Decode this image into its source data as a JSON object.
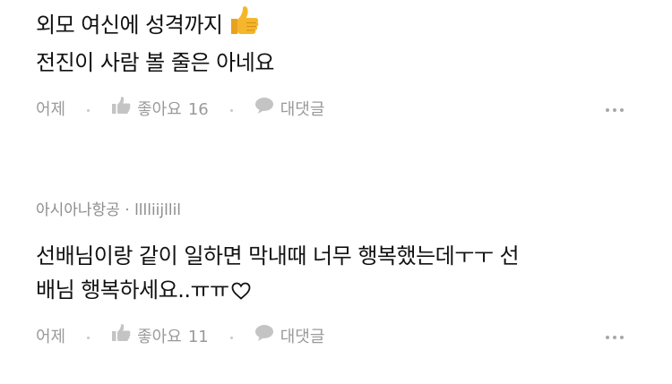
{
  "comments": [
    {
      "author": "",
      "author_sep": "",
      "author_suffix": "",
      "lines": [
        "외모 여신에 성격까지",
        "전진이 사람 볼 줄은 아네요"
      ],
      "emoji": "thumbs-up-emoji",
      "time": "어제",
      "like_label": "좋아요",
      "like_count": "16",
      "reply_label": "대댓글"
    },
    {
      "author": "아시아나항공",
      "author_sep": "·",
      "author_suffix": "lllliijllil",
      "lines": [
        "선배님이랑 같이 일하면 막내때 너무 행복했는데ㅜㅜ 선",
        "배님 행복하세요..ㅠㅠ"
      ],
      "emoji": "heart-outline",
      "time": "어제",
      "like_label": "좋아요",
      "like_count": "11",
      "reply_label": "대댓글"
    }
  ],
  "colors": {
    "text": "#111111",
    "meta": "#8e8e8e",
    "action": "#9a9a9a",
    "icon": "#c4c4c4",
    "emoji": "#f5b62d"
  }
}
